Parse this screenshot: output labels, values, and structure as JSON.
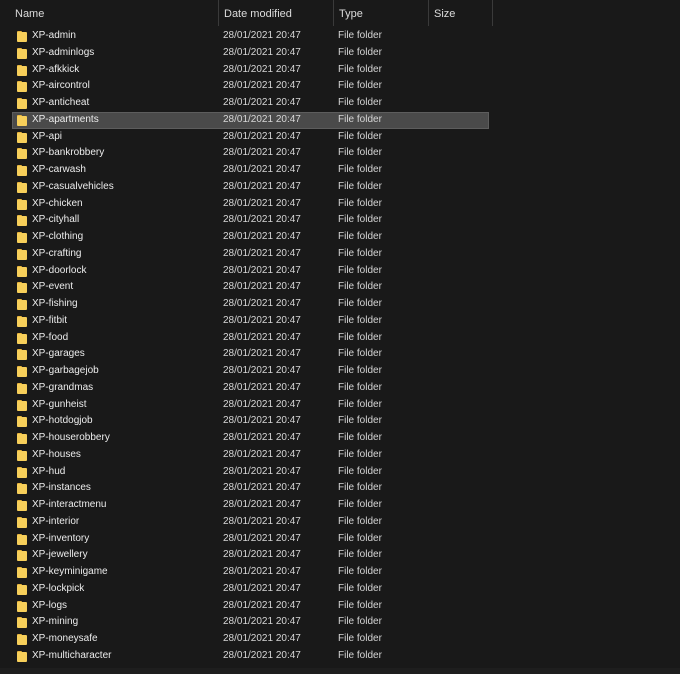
{
  "columns": {
    "name": "Name",
    "date": "Date modified",
    "type": "Type",
    "size": "Size"
  },
  "sort_icon": "chevron-up-icon",
  "accent": {
    "folder": "#f7cf5a",
    "selection": "#4a4a4a"
  },
  "selected_index": 5,
  "files": [
    {
      "name": "XP-admin",
      "date": "28/01/2021 20:47",
      "type": "File folder"
    },
    {
      "name": "XP-adminlogs",
      "date": "28/01/2021 20:47",
      "type": "File folder"
    },
    {
      "name": "XP-afkkick",
      "date": "28/01/2021 20:47",
      "type": "File folder"
    },
    {
      "name": "XP-aircontrol",
      "date": "28/01/2021 20:47",
      "type": "File folder"
    },
    {
      "name": "XP-anticheat",
      "date": "28/01/2021 20:47",
      "type": "File folder"
    },
    {
      "name": "XP-apartments",
      "date": "28/01/2021 20:47",
      "type": "File folder"
    },
    {
      "name": "XP-api",
      "date": "28/01/2021 20:47",
      "type": "File folder"
    },
    {
      "name": "XP-bankrobbery",
      "date": "28/01/2021 20:47",
      "type": "File folder"
    },
    {
      "name": "XP-carwash",
      "date": "28/01/2021 20:47",
      "type": "File folder"
    },
    {
      "name": "XP-casualvehicles",
      "date": "28/01/2021 20:47",
      "type": "File folder"
    },
    {
      "name": "XP-chicken",
      "date": "28/01/2021 20:47",
      "type": "File folder"
    },
    {
      "name": "XP-cityhall",
      "date": "28/01/2021 20:47",
      "type": "File folder"
    },
    {
      "name": "XP-clothing",
      "date": "28/01/2021 20:47",
      "type": "File folder"
    },
    {
      "name": "XP-crafting",
      "date": "28/01/2021 20:47",
      "type": "File folder"
    },
    {
      "name": "XP-doorlock",
      "date": "28/01/2021 20:47",
      "type": "File folder"
    },
    {
      "name": "XP-event",
      "date": "28/01/2021 20:47",
      "type": "File folder"
    },
    {
      "name": "XP-fishing",
      "date": "28/01/2021 20:47",
      "type": "File folder"
    },
    {
      "name": "XP-fitbit",
      "date": "28/01/2021 20:47",
      "type": "File folder"
    },
    {
      "name": "XP-food",
      "date": "28/01/2021 20:47",
      "type": "File folder"
    },
    {
      "name": "XP-garages",
      "date": "28/01/2021 20:47",
      "type": "File folder"
    },
    {
      "name": "XP-garbagejob",
      "date": "28/01/2021 20:47",
      "type": "File folder"
    },
    {
      "name": "XP-grandmas",
      "date": "28/01/2021 20:47",
      "type": "File folder"
    },
    {
      "name": "XP-gunheist",
      "date": "28/01/2021 20:47",
      "type": "File folder"
    },
    {
      "name": "XP-hotdogjob",
      "date": "28/01/2021 20:47",
      "type": "File folder"
    },
    {
      "name": "XP-houserobbery",
      "date": "28/01/2021 20:47",
      "type": "File folder"
    },
    {
      "name": "XP-houses",
      "date": "28/01/2021 20:47",
      "type": "File folder"
    },
    {
      "name": "XP-hud",
      "date": "28/01/2021 20:47",
      "type": "File folder"
    },
    {
      "name": "XP-instances",
      "date": "28/01/2021 20:47",
      "type": "File folder"
    },
    {
      "name": "XP-interactmenu",
      "date": "28/01/2021 20:47",
      "type": "File folder"
    },
    {
      "name": "XP-interior",
      "date": "28/01/2021 20:47",
      "type": "File folder"
    },
    {
      "name": "XP-inventory",
      "date": "28/01/2021 20:47",
      "type": "File folder"
    },
    {
      "name": "XP-jewellery",
      "date": "28/01/2021 20:47",
      "type": "File folder"
    },
    {
      "name": "XP-keyminigame",
      "date": "28/01/2021 20:47",
      "type": "File folder"
    },
    {
      "name": "XP-lockpick",
      "date": "28/01/2021 20:47",
      "type": "File folder"
    },
    {
      "name": "XP-logs",
      "date": "28/01/2021 20:47",
      "type": "File folder"
    },
    {
      "name": "XP-mining",
      "date": "28/01/2021 20:47",
      "type": "File folder"
    },
    {
      "name": "XP-moneysafe",
      "date": "28/01/2021 20:47",
      "type": "File folder"
    },
    {
      "name": "XP-multicharacter",
      "date": "28/01/2021 20:47",
      "type": "File folder"
    }
  ]
}
